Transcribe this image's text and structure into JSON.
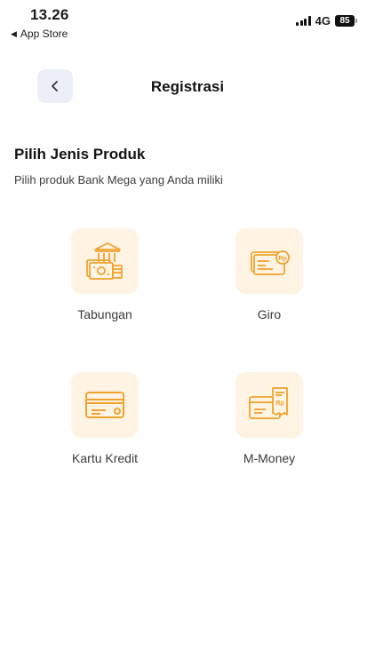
{
  "status_bar": {
    "time": "13.26",
    "back_app_label": "App Store",
    "network": "4G",
    "battery": "85"
  },
  "header": {
    "title": "Registrasi"
  },
  "section": {
    "title": "Pilih Jenis Produk",
    "subtitle": "Pilih produk Bank Mega yang Anda miliki"
  },
  "products": [
    {
      "label": "Tabungan",
      "icon": "bank-savings-icon"
    },
    {
      "label": "Giro",
      "icon": "checking-card-icon"
    },
    {
      "label": "Kartu Kredit",
      "icon": "credit-card-icon"
    },
    {
      "label": "M-Money",
      "icon": "mmoney-card-receipt-icon"
    }
  ],
  "colors": {
    "accent": "#f0a22e",
    "tile_bg": "#fff3e3",
    "back_button_bg": "#eceff7"
  }
}
